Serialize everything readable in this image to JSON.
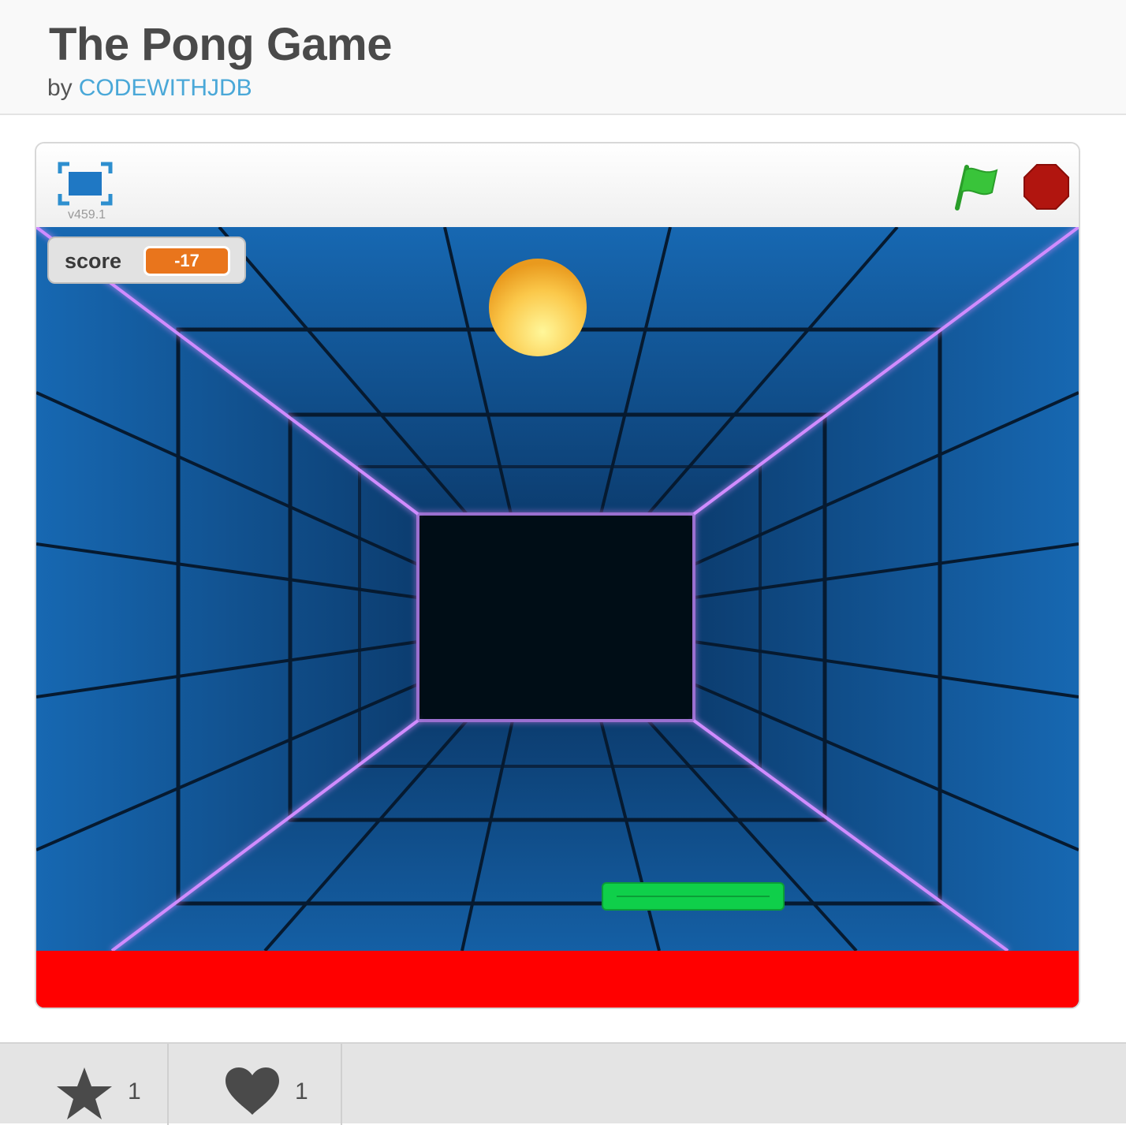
{
  "project": {
    "title": "The Pong Game",
    "by_label": "by",
    "author": "CODEWITHJDB"
  },
  "player": {
    "version": "v459.1",
    "icons": {
      "fullscreen": "fullscreen-icon",
      "green_flag": "green-flag-icon",
      "stop": "stop-sign-icon"
    }
  },
  "stage": {
    "score_label": "score",
    "score_value": "-17",
    "colors": {
      "wall": "#1462a8",
      "back_wall": "#050e18",
      "neon": "#d08cff",
      "ball": "#f7b52b",
      "paddle": "#0fcf4a",
      "floor_bar": "#ff0000",
      "score_badge": "#e9751c"
    }
  },
  "stats": {
    "stars": {
      "icon": "star-icon",
      "count": "1"
    },
    "loves": {
      "icon": "heart-icon",
      "count": "1"
    }
  }
}
